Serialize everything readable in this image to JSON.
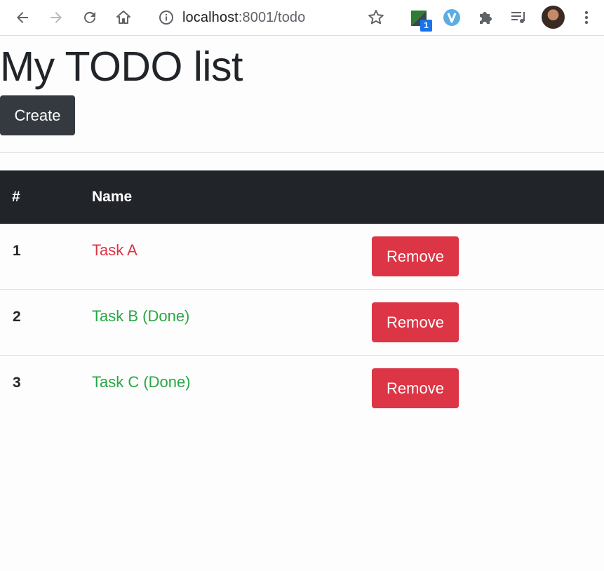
{
  "browser": {
    "url_host": "localhost",
    "url_path": ":8001/todo",
    "extension_badge": "1",
    "icons": [
      "back-icon",
      "forward-icon",
      "reload-icon",
      "home-icon",
      "info-icon",
      "star-icon",
      "extension-green-icon",
      "extension-v-icon",
      "puzzle-icon",
      "playlist-icon",
      "avatar",
      "menu-dots-icon"
    ]
  },
  "page": {
    "title": "My TODO list",
    "create_label": "Create"
  },
  "table": {
    "headers": {
      "num": "#",
      "name": "Name"
    },
    "rows": [
      {
        "num": "1",
        "name": "Task A",
        "status_color": "#dc3545",
        "remove_label": "Remove"
      },
      {
        "num": "2",
        "name": "Task B (Done)",
        "status_color": "#28a745",
        "remove_label": "Remove"
      },
      {
        "num": "3",
        "name": "Task C (Done)",
        "status_color": "#28a745",
        "remove_label": "Remove"
      }
    ]
  },
  "colors": {
    "dark": "#343a40",
    "header_bg": "#212529",
    "danger": "#dc3545",
    "success": "#28a745"
  }
}
